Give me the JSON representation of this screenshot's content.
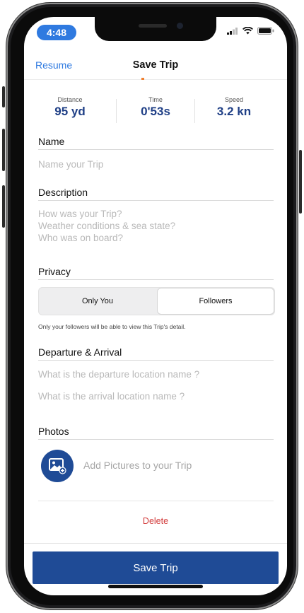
{
  "status_bar": {
    "time": "4:48"
  },
  "navbar": {
    "back_label": "Resume",
    "title": "Save Trip"
  },
  "stats": [
    {
      "label": "Distance",
      "value": "95 yd"
    },
    {
      "label": "Time",
      "value": "0'53s"
    },
    {
      "label": "Speed",
      "value": "3.2 kn"
    }
  ],
  "name": {
    "label": "Name",
    "placeholder": "Name your Trip"
  },
  "description": {
    "label": "Description",
    "placeholder_lines": [
      "How was your Trip?",
      "Weather conditions & sea state?",
      "Who was on board?"
    ]
  },
  "privacy": {
    "label": "Privacy",
    "options": [
      "Only You",
      "Followers"
    ],
    "selected": "Followers",
    "note": "Only your followers will be able to view this Trip's detail."
  },
  "departure_arrival": {
    "label": "Departure & Arrival",
    "departure_placeholder": "What is the departure location name ?",
    "arrival_placeholder": "What is the arrival location name ?"
  },
  "photos": {
    "label": "Photos",
    "add_text": "Add Pictures to your Trip"
  },
  "delete_label": "Delete",
  "save_label": "Save Trip",
  "colors": {
    "accent_blue": "#2f7ae0",
    "brand_navy": "#1f4b96",
    "danger_red": "#d23b3b"
  }
}
